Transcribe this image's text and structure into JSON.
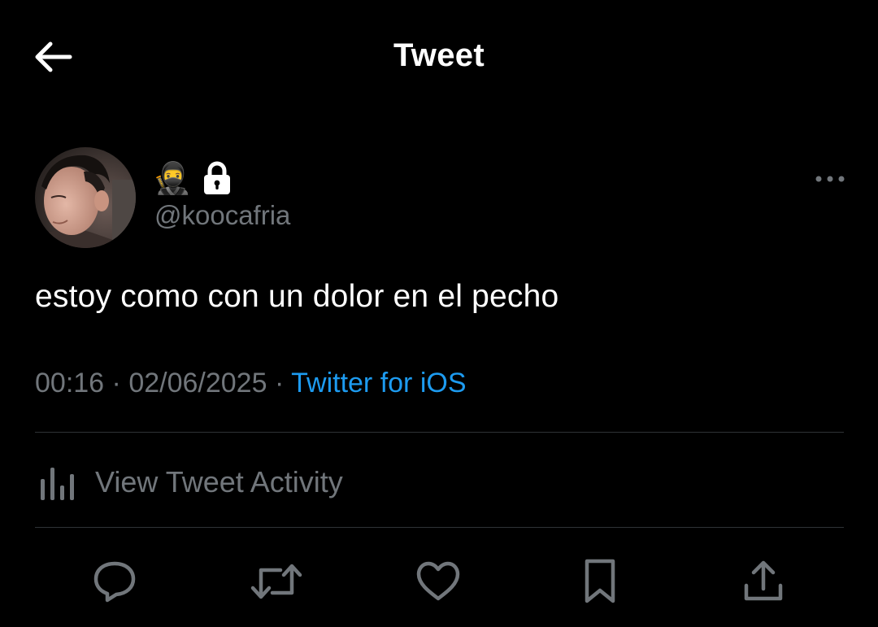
{
  "header": {
    "title": "Tweet",
    "back_icon": "arrow-left-icon"
  },
  "author": {
    "display_name_emoji": "🥷",
    "protected_icon": "lock-icon",
    "handle": "@koocafria"
  },
  "tweet": {
    "text": "estoy como con un dolor en el pecho",
    "time": "00:16",
    "date": "02/06/2025",
    "separator": "·",
    "source": "Twitter for iOS"
  },
  "activity": {
    "label": "View Tweet Activity",
    "icon": "bar-chart-icon"
  },
  "actions": {
    "reply_icon": "reply-icon",
    "retweet_icon": "retweet-icon",
    "like_icon": "heart-icon",
    "bookmark_icon": "bookmark-icon",
    "share_icon": "share-icon"
  },
  "colors": {
    "background": "#000000",
    "text": "#ffffff",
    "secondary": "#71767b",
    "link": "#1d9bf0",
    "divider": "#2f3336"
  }
}
